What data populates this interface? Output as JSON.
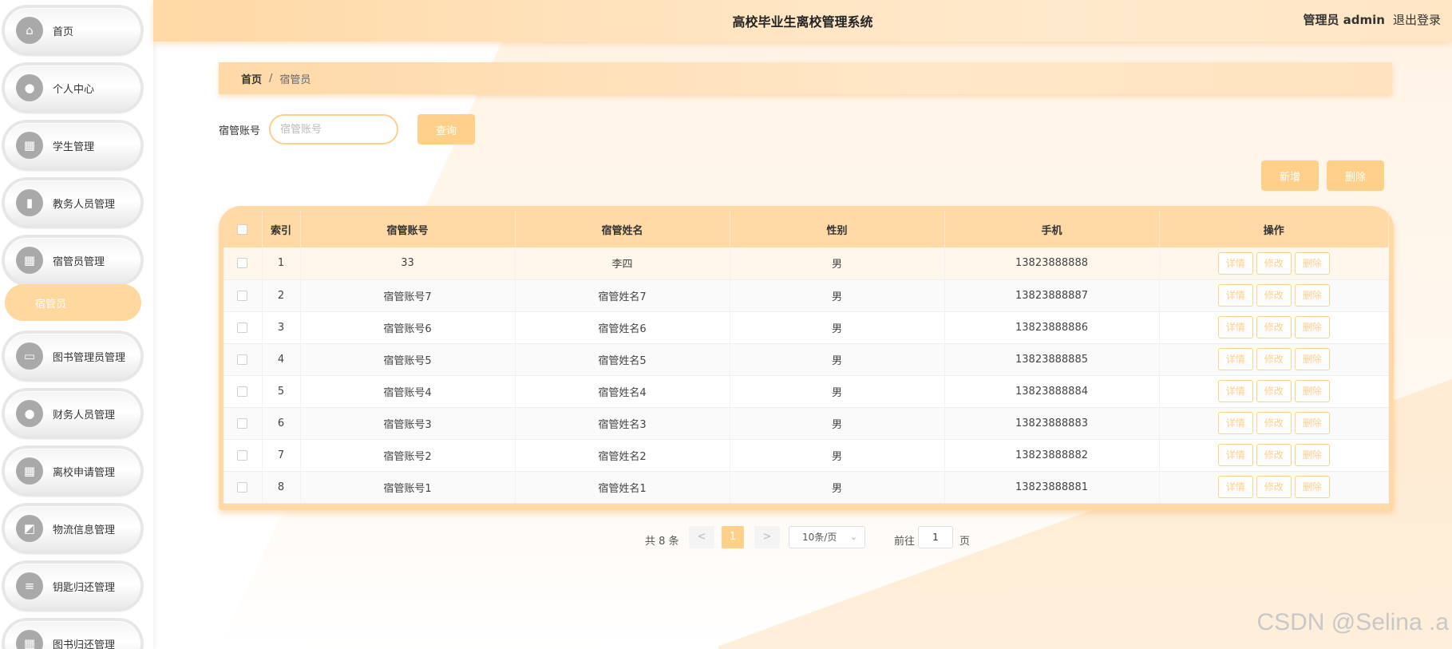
{
  "header": {
    "title": "高校毕业生离校管理系统",
    "user": "管理员 admin",
    "logout": "退出登录"
  },
  "sidebar": {
    "items": [
      {
        "label": "首页",
        "icon": "home-icon"
      },
      {
        "label": "个人中心",
        "icon": "user-icon"
      },
      {
        "label": "学生管理",
        "icon": "grid-icon"
      },
      {
        "label": "教务人员管理",
        "icon": "bar-chart-icon"
      },
      {
        "label": "宿管员管理",
        "icon": "grid-icon"
      },
      {
        "label": "图书管理员管理",
        "icon": "monitor-icon"
      },
      {
        "label": "财务人员管理",
        "icon": "person-icon"
      },
      {
        "label": "离校申请管理",
        "icon": "grid-icon"
      },
      {
        "label": "物流信息管理",
        "icon": "chart-icon"
      },
      {
        "label": "钥匙归还管理",
        "icon": "list-icon"
      },
      {
        "label": "图书归还管理",
        "icon": "grid-icon"
      }
    ],
    "active_sub": "宿管员"
  },
  "breadcrumb": {
    "home": "首页",
    "sep": "/",
    "current": "宿管员"
  },
  "search": {
    "label": "宿管账号",
    "placeholder": "宿管账号",
    "button": "查询"
  },
  "actions": {
    "add": "新增",
    "delete": "删除"
  },
  "table": {
    "headers": [
      "索引",
      "宿管账号",
      "宿管姓名",
      "性别",
      "手机",
      "操作"
    ],
    "ops": [
      "详情",
      "修改",
      "删除"
    ],
    "rows": [
      {
        "idx": "1",
        "account": "33",
        "name": "李四",
        "gender": "男",
        "phone": "13823888888"
      },
      {
        "idx": "2",
        "account": "宿管账号7",
        "name": "宿管姓名7",
        "gender": "男",
        "phone": "13823888887"
      },
      {
        "idx": "3",
        "account": "宿管账号6",
        "name": "宿管姓名6",
        "gender": "男",
        "phone": "13823888886"
      },
      {
        "idx": "4",
        "account": "宿管账号5",
        "name": "宿管姓名5",
        "gender": "男",
        "phone": "13823888885"
      },
      {
        "idx": "5",
        "account": "宿管账号4",
        "name": "宿管姓名4",
        "gender": "男",
        "phone": "13823888884"
      },
      {
        "idx": "6",
        "account": "宿管账号3",
        "name": "宿管姓名3",
        "gender": "男",
        "phone": "13823888883"
      },
      {
        "idx": "7",
        "account": "宿管账号2",
        "name": "宿管姓名2",
        "gender": "男",
        "phone": "13823888882"
      },
      {
        "idx": "8",
        "account": "宿管账号1",
        "name": "宿管姓名1",
        "gender": "男",
        "phone": "13823888881"
      }
    ]
  },
  "pagination": {
    "total": "共 8 条",
    "prev": "<",
    "current": "1",
    "next": ">",
    "page_size": "10条/页",
    "goto": "前往",
    "goto_value": "1",
    "page_suffix": "页"
  },
  "watermark": "CSDN @Selina .a",
  "colors": {
    "accent": "#ffd08a",
    "header": "#ffe3bd"
  }
}
